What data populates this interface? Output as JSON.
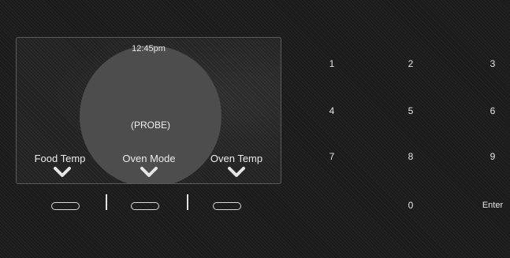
{
  "display": {
    "time": "12:45pm",
    "mode_text": "(PROBE)",
    "soft_labels": {
      "left": "Food Temp",
      "center": "Oven Mode",
      "right": "Oven Temp"
    }
  },
  "keypad": {
    "k1": "1",
    "k2": "2",
    "k3": "3",
    "k4": "4",
    "k5": "5",
    "k6": "6",
    "k7": "7",
    "k8": "8",
    "k9": "9",
    "k0": "0",
    "enter": "Enter"
  },
  "icons": {
    "chevron": "chevron-down-icon",
    "softkey": "softkey-button"
  },
  "colors": {
    "background": "#1b1b1b",
    "dial": "#4d4d4d",
    "text": "#e8e8e8"
  }
}
